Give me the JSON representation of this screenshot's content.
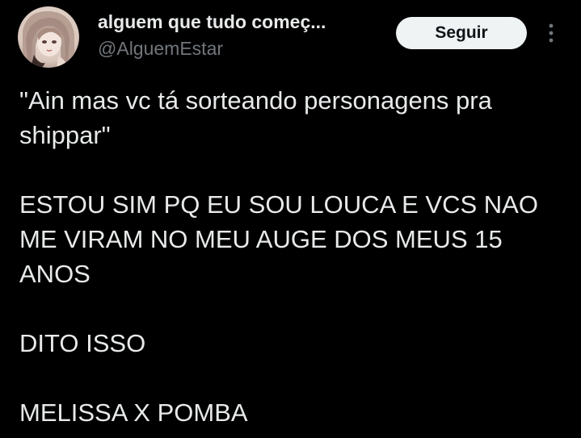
{
  "author": {
    "display_name": "alguem que tudo começ...",
    "handle": "@AlguemEstar",
    "avatar_icon": "profile-avatar"
  },
  "actions": {
    "follow_label": "Seguir",
    "more_icon": "more-vertical-icon"
  },
  "tweet": {
    "line1": "\"Ain mas vc tá sorteando personagens pra shippar\"",
    "line2": "ESTOU SIM PQ EU SOU LOUCA E VCS NAO ME VIRAM NO MEU AUGE DOS MEUS 15 ANOS",
    "line3": "DITO ISSO",
    "line4": "MELISSA X POMBA"
  },
  "colors": {
    "background": "#000000",
    "text_primary": "#e7e9ea",
    "text_secondary": "#71767b",
    "button_bg": "#eff3f4",
    "button_text": "#0f1419"
  }
}
